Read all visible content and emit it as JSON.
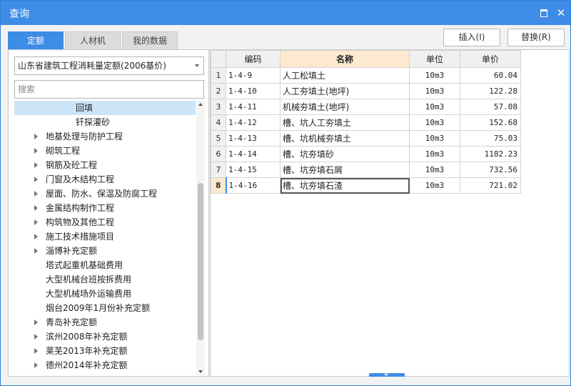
{
  "window": {
    "title": "查询"
  },
  "tabs": [
    {
      "label": "定额",
      "active": true
    },
    {
      "label": "人材机",
      "active": false
    },
    {
      "label": "我的数据",
      "active": false
    }
  ],
  "buttons": {
    "insert": "插入(I)",
    "replace": "替换(R)"
  },
  "library_select": {
    "value": "山东省建筑工程消耗量定额(2006基价)"
  },
  "search": {
    "placeholder": "搜索",
    "value": ""
  },
  "tree": [
    {
      "label": "回填",
      "indent": 2,
      "expandable": false,
      "selected": true
    },
    {
      "label": "钎探灌砂",
      "indent": 2,
      "expandable": false
    },
    {
      "label": "地基处理与防护工程",
      "indent": 1,
      "expandable": true
    },
    {
      "label": "砌筑工程",
      "indent": 1,
      "expandable": true
    },
    {
      "label": "钢筋及砼工程",
      "indent": 1,
      "expandable": true
    },
    {
      "label": "门窗及木结构工程",
      "indent": 1,
      "expandable": true
    },
    {
      "label": "屋面、防水、保温及防腐工程",
      "indent": 1,
      "expandable": true
    },
    {
      "label": "金属结构制作工程",
      "indent": 1,
      "expandable": true
    },
    {
      "label": "构筑物及其他工程",
      "indent": 1,
      "expandable": true
    },
    {
      "label": "施工技术措施项目",
      "indent": 1,
      "expandable": true
    },
    {
      "label": "淄博补充定额",
      "indent": 1,
      "expandable": true
    },
    {
      "label": "塔式起重机基础费用",
      "indent": 1,
      "expandable": false
    },
    {
      "label": "大型机械台班按拆费用",
      "indent": 1,
      "expandable": false
    },
    {
      "label": "大型机械场外运输费用",
      "indent": 1,
      "expandable": false
    },
    {
      "label": "烟台2009年1月份补充定额",
      "indent": 1,
      "expandable": false
    },
    {
      "label": "青岛补充定额",
      "indent": 1,
      "expandable": true
    },
    {
      "label": "滨州2008年补充定额",
      "indent": 1,
      "expandable": true
    },
    {
      "label": "莱芜2013年补充定额",
      "indent": 1,
      "expandable": true
    },
    {
      "label": "德州2014年补充定额",
      "indent": 1,
      "expandable": true
    }
  ],
  "grid": {
    "columns": [
      "编码",
      "名称",
      "单位",
      "单价"
    ],
    "rows": [
      {
        "num": "1",
        "code": "1-4-9",
        "name": "人工松填土",
        "unit": "10m3",
        "price": "60.04"
      },
      {
        "num": "2",
        "code": "1-4-10",
        "name": "人工夯填土(地坪)",
        "unit": "10m3",
        "price": "122.28"
      },
      {
        "num": "3",
        "code": "1-4-11",
        "name": "机械夯填土(地坪)",
        "unit": "10m3",
        "price": "57.08"
      },
      {
        "num": "4",
        "code": "1-4-12",
        "name": "槽、坑人工夯填土",
        "unit": "10m3",
        "price": "152.68"
      },
      {
        "num": "5",
        "code": "1-4-13",
        "name": "槽、坑机械夯填土",
        "unit": "10m3",
        "price": "75.03"
      },
      {
        "num": "6",
        "code": "1-4-14",
        "name": "槽、坑夯填砂",
        "unit": "10m3",
        "price": "1182.23"
      },
      {
        "num": "7",
        "code": "1-4-15",
        "name": "槽、坑夯填石屑",
        "unit": "10m3",
        "price": "732.56"
      },
      {
        "num": "8",
        "code": "1-4-16",
        "name": "槽、坑夯填石渣",
        "unit": "10m3",
        "price": "721.02"
      }
    ],
    "active_row": 7
  },
  "colors": {
    "accent": "#3d8ce6",
    "selected_row": "#cce4f7",
    "header_highlight": "#fde9cf"
  }
}
